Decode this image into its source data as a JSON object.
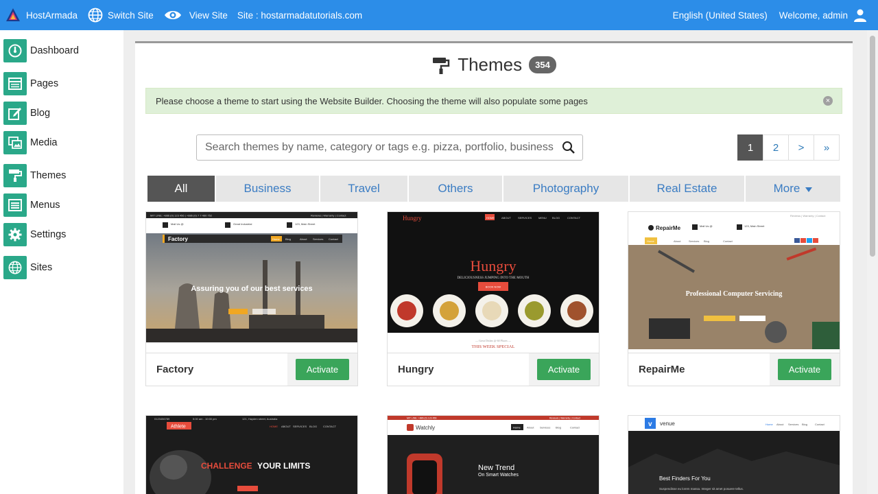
{
  "topbar": {
    "brand": "HostArmada",
    "switch_site": "Switch Site",
    "view_site": "View Site",
    "site_label": "Site : hostarmadatutorials.com",
    "language": "English (United States)",
    "welcome": "Welcome, admin"
  },
  "sidebar": {
    "items": [
      {
        "label": "Dashboard",
        "icon": "dashboard-icon"
      },
      {
        "label": "Pages",
        "icon": "pages-icon"
      },
      {
        "label": "Blog",
        "icon": "blog-icon"
      },
      {
        "label": "Media",
        "icon": "media-icon"
      },
      {
        "label": "Themes",
        "icon": "paint-roller-icon"
      },
      {
        "label": "Menus",
        "icon": "menus-icon"
      },
      {
        "label": "Settings",
        "icon": "gear-icon"
      },
      {
        "label": "Sites",
        "icon": "globe-icon"
      }
    ]
  },
  "main": {
    "title": "Themes",
    "count": "354",
    "alert": "Please choose a theme to start using the Website Builder. Choosing the theme will also populate some pages",
    "search_placeholder": "Search themes by name, category or tags e.g. pizza, portfolio, business",
    "pager": [
      "1",
      "2",
      ">",
      "»"
    ],
    "tabs": [
      "All",
      "Business",
      "Travel",
      "Others",
      "Photography",
      "Real Estate",
      "More"
    ],
    "themes": [
      {
        "name": "Factory",
        "button": "Activate",
        "preview": {
          "topline": "MIT LINE: +886 (0) 123 456 | +886 (0) 7 7 460 752",
          "toplinks": "Reviews | Warranty | Contact",
          "brand": "Factory",
          "nav": [
            "Home",
            "Blog",
            "About",
            "Services",
            "Contact"
          ],
          "info": [
            "Mail Us @",
            "Great Industrial",
            "123, Main Street"
          ],
          "headline": "Assuring you of our best services"
        }
      },
      {
        "name": "Hungry",
        "button": "Activate",
        "preview": {
          "brand": "Hungry",
          "nav": [
            "HOME",
            "ABOUT",
            "SERVICES",
            "MENU",
            "BLOG",
            "CONTACT"
          ],
          "headline": "Hungry",
          "sub": "DELICIOUSNESS JUMPING INTO THE MOUTH",
          "cta": "BOOK NOW",
          "bottom_small": "— Great Dishes @ 60 Places —",
          "bottom": "THIS WEEK SPECIAL"
        }
      },
      {
        "name": "RepairMe",
        "button": "Activate",
        "preview": {
          "brand": "RepairMe",
          "toplinks": "Reviews | Warranty | Contact",
          "nav": [
            "Home",
            "About",
            "Services",
            "Blog",
            "Contact"
          ],
          "info": [
            "Mail Us @",
            "123, Main Street"
          ],
          "headline": "Professional Computer Servicing"
        }
      },
      {
        "name": "Athlete",
        "preview": {
          "brand": "Athlete",
          "topline": "0123456789",
          "topline2": "5:00 am - 10:00 pm",
          "topline3": "121, Hayden street, Australia",
          "nav": [
            "HOME",
            "ABOUT",
            "SERVICES",
            "BLOG",
            "CONTACT"
          ],
          "headline_red": "CHALLENGE",
          "headline": "YOUR LIMITS"
        }
      },
      {
        "name": "Watchly",
        "preview": {
          "brand": "Watchly",
          "topline": "MIT LINE: +886 (0) 123 456",
          "toplinks": "Reviews | Warranty | Contact",
          "nav": [
            "Home",
            "About",
            "Services",
            "Blog",
            "Contact"
          ],
          "headline": "New Trend",
          "sub": "On Smart Watches"
        }
      },
      {
        "name": "venue",
        "preview": {
          "brand": "venue",
          "nav": [
            "Home",
            "About",
            "Services",
            "Blog",
            "Contact"
          ],
          "headline": "Best Finders For You",
          "sub": "Suspendisse eu lorem massa. Integer sit amet posuere tellus."
        }
      }
    ]
  },
  "colors": {
    "topbar": "#2c8de8",
    "sidebar_icon": "#2aa889",
    "activate": "#3aa55a",
    "tab_active": "#555555",
    "alert_bg": "#dff0d8"
  }
}
